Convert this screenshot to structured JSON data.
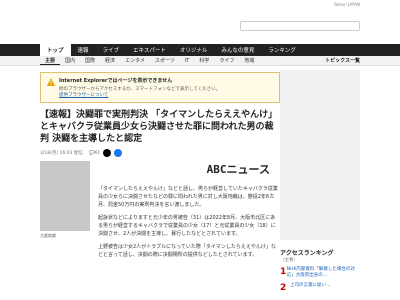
{
  "topstrip": {
    "text": "Yahoo! JAPAN"
  },
  "nav_primary": [
    "トップ",
    "速報",
    "ライブ",
    "エキスパート",
    "オリジナル",
    "みんなの意見",
    "ランキング"
  ],
  "nav_secondary": [
    "主要",
    "国内",
    "国際",
    "経済",
    "エンタメ",
    "スポーツ",
    "IT",
    "科学",
    "ライフ",
    "地域"
  ],
  "nav_secondary_right": "トピックス一覧",
  "warning": {
    "title": "Internet Explorerではページを表示できません",
    "body": "他のブラウザーからアクセスするか、スマートフォンなどで表示してください。",
    "link": "提供ブラウザーについて"
  },
  "article": {
    "title": "【速報】決闘罪で実刑判決 「タイマンしたらええやんけ」とキャバクラ従業員少女ら決闘させた罪に問われた男の裁判 決闘を主導したと認定",
    "date": "3/18(月) 16:03 配信",
    "comments": "61",
    "brand": "ABCニュース",
    "photo_caption": "大阪地裁",
    "paragraphs": [
      "「タイマンしたらええやんけ」などと話し、男らが経営していたキャバクラ従業員の少女らに決闘させたなどの罪に問われた男に対し大阪地裁は、懲役2年6カ月、罰金50万円の実刑判決を言い渡しました。",
      "起訴状などによりますと元少年の男被告（31）は2022年8月、大阪市北区にある男らが経営するキャバクラで従業員の少女（17）と元従業員の少女（18）に決闘させ、2人が決闘を主導し、暴行したなどとされています。",
      "上野被告は少女2人がトラブルになっていた際「タイマンしたらええやんけ」などと言って話し、決闘の際に決闘場所の提供などしたとされています。"
    ]
  },
  "ranking": {
    "title": "アクセスランキング",
    "sub": "（主要）",
    "items": [
      {
        "no": "1",
        "text": "NHK内部資料「解散した場合の対応」大阪府出身の…"
      },
      {
        "no": "2",
        "text": "上司の言葉に従い…"
      }
    ]
  }
}
